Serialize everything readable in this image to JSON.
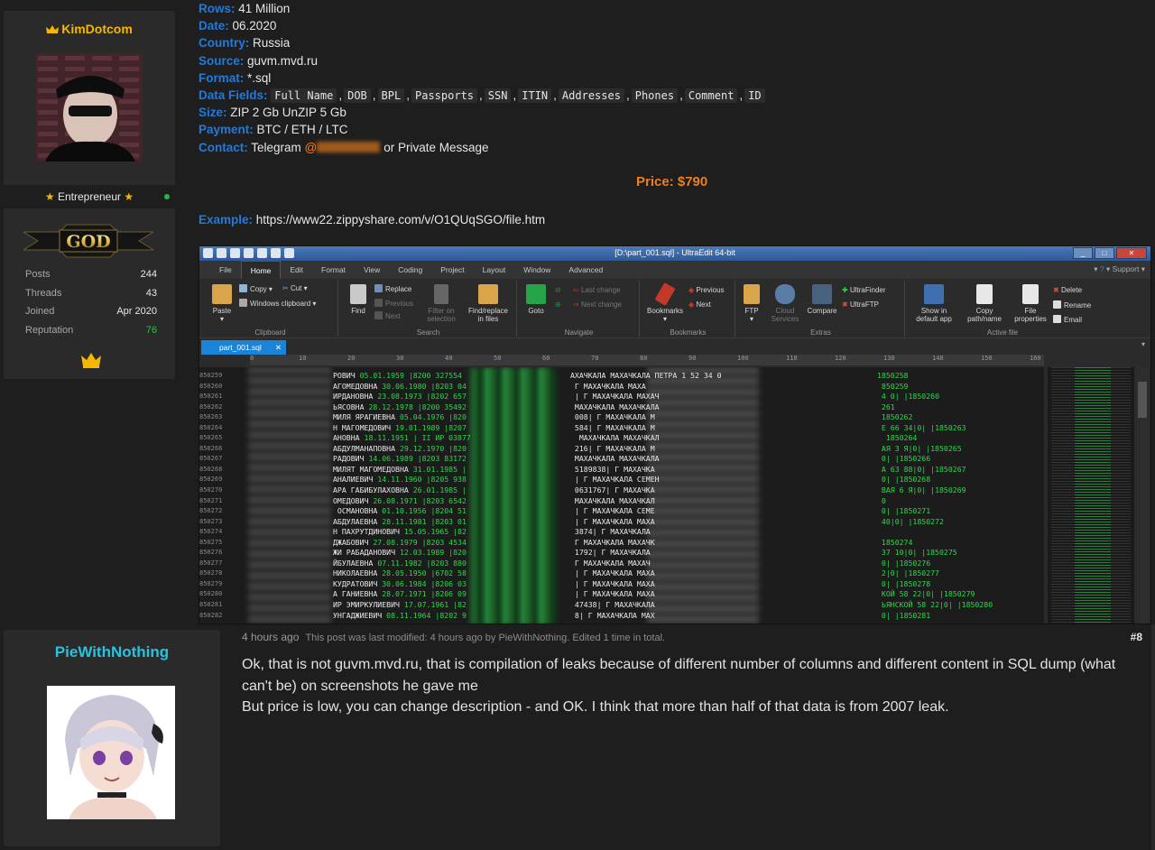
{
  "post1": {
    "user": {
      "name": "KimDotcom",
      "title": "Entrepreneur",
      "rank_badge": "GOD",
      "stats": [
        {
          "label": "Posts",
          "value": "244"
        },
        {
          "label": "Threads",
          "value": "43"
        },
        {
          "label": "Joined",
          "value": "Apr 2020"
        },
        {
          "label": "Reputation",
          "value": "76"
        }
      ],
      "crown_icon": "crown-icon",
      "online_color": "#29b54a"
    },
    "fields": {
      "rows_label": "Rows:",
      "rows_value": "41 Million",
      "date_label": "Date:",
      "date_value": "06.2020",
      "country_label": "Country:",
      "country_value": "Russia",
      "source_label": "Source:",
      "source_value": "guvm.mvd.ru",
      "format_label": "Format:",
      "format_value": "*.sql",
      "datafields_label": "Data Fields:",
      "data_fields": [
        "Full Name",
        "DOB",
        "BPL",
        "Passports",
        "SSN",
        "ITIN",
        "Addresses",
        "Phones",
        "Comment",
        "ID"
      ],
      "size_label": "Size:",
      "size_value": "ZIP 2 Gb UnZIP 5 Gb",
      "payment_label": "Payment:",
      "payment_value": "BTC / ETH / LTC",
      "contact_label": "Contact:",
      "contact_prefix": "Telegram ",
      "contact_at": "@",
      "contact_suffix": "or Private Message",
      "price": "Price: $790",
      "example_label": "Example:",
      "example_url": "https://www22.zippyshare.com/v/O1QUqSGO/file.htm"
    },
    "colors": {
      "label": "#1f7be0",
      "price": "#f07e1a",
      "username": "#f5b800"
    }
  },
  "ultraedit": {
    "window_title": "[D:\\part_001.sql] - UltraEdit 64-bit",
    "menu": [
      "File",
      "Home",
      "Edit",
      "Format",
      "View",
      "Coding",
      "Project",
      "Layout",
      "Window",
      "Advanced"
    ],
    "menu_right": "Support",
    "groups": {
      "clipboard": "Clipboard",
      "search": "Search",
      "navigate": "Navigate",
      "bookmarks": "Bookmarks",
      "extras": "Extras",
      "active_file": "Active file"
    },
    "buttons": {
      "paste": "Paste",
      "copy": "Copy",
      "cut": "Cut",
      "windows_clipboard": "Windows clipboard",
      "find": "Find",
      "replace": "Replace",
      "previous": "Previous",
      "next": "Next",
      "filter1": "Filter on",
      "filter2": "selection",
      "find_replace1": "Find/replace",
      "find_replace2": "in files",
      "goto": "Goto",
      "last_change": "Last change",
      "next_change": "Next change",
      "bookmarks": "Bookmarks",
      "bm_previous": "Previous",
      "bm_next": "Next",
      "ftp": "FTP",
      "cloud1": "Cloud",
      "cloud2": "Services",
      "compare": "Compare",
      "ultrafinder": "UltraFinder",
      "ultraftp": "UltraFTP",
      "show1": "Show in",
      "show2": "default app",
      "copy_path1": "Copy",
      "copy_path2": "path/name",
      "file_props1": "File",
      "file_props2": "properties",
      "delete": "Delete",
      "rename": "Rename",
      "email": "Email"
    },
    "tab": "part_001.sql",
    "ruler": [
      "0",
      "10",
      "20",
      "30",
      "40",
      "50",
      "60",
      "70",
      "80",
      "90",
      "100",
      "110",
      "120",
      "130",
      "140",
      "150",
      "160"
    ],
    "line_numbers": [
      "850259",
      "850260",
      "850261",
      "850262",
      "850263",
      "850264",
      "850265",
      "850266",
      "850267",
      "850268",
      "850269",
      "850270",
      "850271",
      "850272",
      "850273",
      "850274",
      "850275",
      "850276",
      "850277",
      "850278",
      "850279",
      "850280",
      "850281",
      "850282"
    ],
    "rows": [
      {
        "a": "РОВИЧ",
        "b": "05.01.1959",
        "c": "|8200 327554",
        "d": "АХАЧКАЛА МАХАЧКАЛА ПЕТРА 1 52 34 0",
        "e": "1850258"
      },
      {
        "a": "АГОМЕДОВНА",
        "b": "30.06.1980",
        "c": "|8203 04",
        "d": "Г МАХАЧКАЛА МАХА",
        "e": "850259"
      },
      {
        "a": "ИРДАНОВНА",
        "b": "23.08.1973",
        "c": "|8202 657",
        "d": "| Г МАХАЧКАЛА МАХАЧ",
        "e": "4 0| |1850260"
      },
      {
        "a": "ЬЯСОВНА",
        "b": "28.12.1978",
        "c": "|8200 35492",
        "d": "МАХАЧКАЛА МАХАЧКАЛА",
        "e": "261"
      },
      {
        "a": "МИЛЯ ЯРАГИЕВНА",
        "b": "05.04.1976",
        "c": "|820",
        "d": "008| Г МАХАЧКАЛА М",
        "e": "1850262"
      },
      {
        "a": "Н МАГОМЕДОВИЧ",
        "b": "19.01.1989",
        "c": "|8207",
        "d": "584| Г МАХАЧКАЛА М",
        "e": "Е 66 34|0| |1850263"
      },
      {
        "a": "АНОВНА",
        "b": "18.11.1951",
        "c": "| II ИР 03877",
        "d": "МАХАЧКАЛА МАХАЧКАЛ",
        "e": "1850264"
      },
      {
        "a": "АБДУЛМАНАПОВНА",
        "b": "29.12.1970",
        "c": "|820",
        "d": "216| Г МАХАЧКАЛА М",
        "e": "АЯ 3 Я|0| |1850265"
      },
      {
        "a": "РАДОВИЧ",
        "b": "14.06.1989",
        "c": "|8203 83172",
        "d": "МАХАЧКАЛА МАХАЧКАЛА",
        "e": "0| |1850266"
      },
      {
        "a": "МИЛЯТ МАГОМЕДОВНА",
        "b": "31.01.1985",
        "c": "|",
        "d": "5189838| Г МАХАЧКА",
        "e": "А 63 88|0| |1850267"
      },
      {
        "a": "АНАЛИЕВИЧ",
        "b": "14.11.1960",
        "c": "|8205 938",
        "d": "| Г МАХАЧКАЛА СЕМЕН",
        "e": "0| |1850268"
      },
      {
        "a": "АРА ГАБИБУЛАХОВНА",
        "b": "26.01.1985",
        "c": "|",
        "d": "0631767| Г МАХАЧКА",
        "e": "ВАЯ 6 Я|0| |1850269"
      },
      {
        "a": "ОМЕДОВИЧ",
        "b": "26.08.1971",
        "c": "|8203 6542",
        "d": "МАХАЧКАЛА МАХАЧКАЛ",
        "e": "0"
      },
      {
        "a": " ОСМАНОВНА",
        "b": "01.10.1956",
        "c": "|8204 51",
        "d": "| Г МАХАЧКАЛА СЕМЕ",
        "e": "0| |1850271"
      },
      {
        "a": "АБДУЛАЕВНА",
        "b": "28.11.1981",
        "c": "|8203 01",
        "d": "| Г МАХАЧКАЛА МАХА",
        "e": "40|0| |1850272"
      },
      {
        "a": "Н ПАХРУТДИНОВИЧ",
        "b": "15.05.1965",
        "c": "|82",
        "d": "3874| Г МАХАЧКАЛА",
        "e": ""
      },
      {
        "a": "ДЖАБОВИЧ",
        "b": "27.08.1979",
        "c": "|8203 4534",
        "d": "Г МАХАЧКАЛА МАХАЧК",
        "e": "1850274"
      },
      {
        "a": "ЖИ РАБАДАНОВИЧ",
        "b": "12.03.1989",
        "c": "|820",
        "d": "1792| Г МАХАЧКАЛА",
        "e": "37 10|0| |1850275"
      },
      {
        "a": "ЙБУЛАЕВНА",
        "b": "07.11.1982",
        "c": "|8203 880",
        "d": "Г МАХАЧКАЛА МАХАЧ",
        "e": "0| |1850276"
      },
      {
        "a": "НИКОЛАЕВНА",
        "b": "28.05.1950",
        "c": "|6702 58",
        "d": "| Г МАХАЧКАЛА МАХА",
        "e": "2|0| |1850277"
      },
      {
        "a": "КУДРАТОВИЧ",
        "b": "30.06.1984",
        "c": "|8206 03",
        "d": "| Г МАХАЧКАЛА МАХА",
        "e": "0| |1850278"
      },
      {
        "a": "А ГАНИЕВНА",
        "b": "28.07.1971",
        "c": "|8206 09",
        "d": "| Г МАХАЧКАЛА МАХА",
        "e": "КОЙ 58 22|0| |1850279"
      },
      {
        "a": "ИР ЭМИРКУЛИЕВИЧ",
        "b": "17.07.1961",
        "c": "|82",
        "d": "47438| Г МАХАЧКАЛА",
        "e": "ЬЯНСКОЙ 58 22|0| |1850280"
      },
      {
        "a": "УНГАДЖИЕВИЧ",
        "b": "08.11.1964",
        "c": "|8202 9",
        "d": "8| Г МАХАЧКАЛА МАХ",
        "e": "0| |1850281"
      }
    ]
  },
  "post2": {
    "user": {
      "name": "PieWithNothing"
    },
    "time": "4 hours ago",
    "edit_note": "This post was last modified: 4 hours ago by PieWithNothing. Edited 1 time in total.",
    "number": "#8",
    "body_line1": "Ok, that is not guvm.mvd.ru, that is compilation of leaks because of different number of columns and different content in SQL dump (what can't be) on screenshots he gave me",
    "body_line2": "But price is low, you can change description - and OK. I think that more than half of that data is from 2007 leak.",
    "colors": {
      "username": "#27c4e0"
    }
  }
}
